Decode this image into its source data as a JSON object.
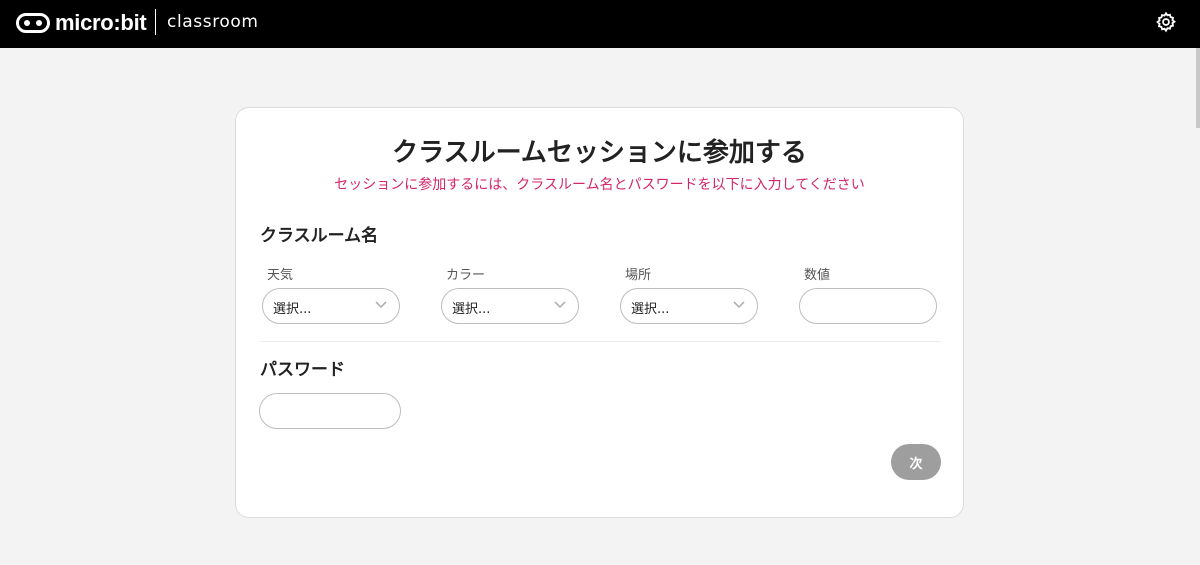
{
  "header": {
    "brand": "micro:bit",
    "product": "classroom",
    "logo_icon": "microbit-logo-icon",
    "settings_icon": "gear-icon"
  },
  "form": {
    "title": "クラスルームセッションに参加する",
    "subtitle": "セッションに参加するには、クラスルーム名とパスワードを以下に入力してください",
    "classroom_name_label": "クラスルーム名",
    "fields": [
      {
        "label": "天気",
        "value": "選択..."
      },
      {
        "label": "カラー",
        "value": "選択..."
      },
      {
        "label": "場所",
        "value": "選択..."
      },
      {
        "label": "数値",
        "value": ""
      }
    ],
    "password_label": "パスワード",
    "password_value": "",
    "next_label": "次"
  },
  "colors": {
    "topbar": "#000000",
    "subtitle": "#d3266b",
    "next_button": "#9e9e9e"
  }
}
